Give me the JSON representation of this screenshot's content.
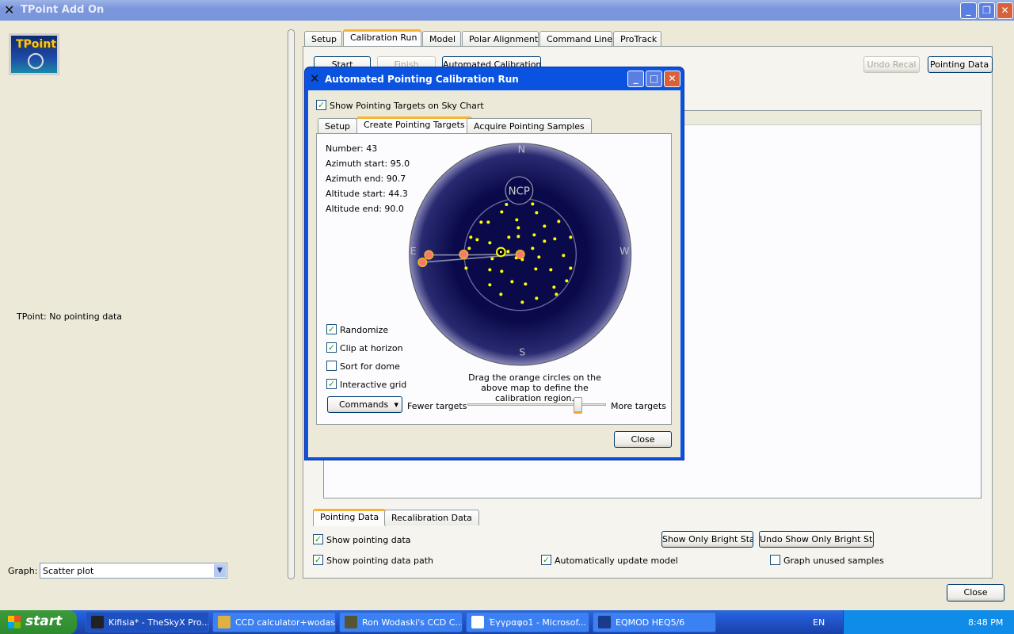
{
  "window": {
    "title": "TPoint Add On",
    "status": "TPoint: No pointing data",
    "graph_label": "Graph:",
    "graph_value": "Scatter plot",
    "close": "Close",
    "logo_text": "TPoint"
  },
  "main_tabs": [
    "Setup",
    "Calibration Run",
    "Model",
    "Polar Alignment",
    "Command Line",
    "ProTrack"
  ],
  "toolbar": {
    "start": "Start",
    "finish": "Finish",
    "automated": "Automated Calibration",
    "undo_recal": "Undo Recal",
    "pointing_data_menu": "Pointing Data"
  },
  "data_tabs": [
    "Pointing Data",
    "Recalibration Data"
  ],
  "options": {
    "show_pointing_data": "Show pointing data",
    "show_pointing_data_path": "Show pointing data path",
    "auto_update": "Automatically update model",
    "graph_unused": "Graph unused samples",
    "show_bright": "Show Only Bright Stars",
    "undo_bright": "Undo Show Only Bright Stars"
  },
  "dialog": {
    "title": "Automated Pointing Calibration Run",
    "show_targets": "Show Pointing Targets on Sky Chart",
    "tabs": [
      "Setup",
      "Create Pointing Targets",
      "Acquire Pointing Samples"
    ],
    "stats": {
      "number": "Number: 43",
      "az_start": "Azimuth start:  95.0",
      "az_end": "Azimuth end:  90.7",
      "alt_start": "Altitude start:  44.3",
      "alt_end": "Altitude end:  90.0"
    },
    "checks": [
      {
        "label": "Randomize",
        "checked": true
      },
      {
        "label": "Clip at horizon",
        "checked": true
      },
      {
        "label": "Sort for dome",
        "checked": false
      },
      {
        "label": "Interactive grid",
        "checked": true
      }
    ],
    "hint": "Drag the orange circles on the above map to define the calibration region.",
    "commands": "Commands",
    "fewer": "Fewer targets",
    "more": "More targets",
    "slider_value": 0.8,
    "close": "Close",
    "compass": {
      "n": "N",
      "s": "S",
      "e": "E",
      "w": "W",
      "ncp": "NCP"
    },
    "colors": {
      "sky": "#0a0a4a",
      "target": "#ffff00",
      "handle": "#f87a6e"
    }
  },
  "taskbar": {
    "start": "start",
    "items": [
      "Kifisia* - TheSkyX Pro...",
      "CCD calculator+wodaski",
      "Ron Wodaski's CCD C...",
      "Έγγραφο1 - Microsof...",
      "EQMOD HEQ5/6"
    ],
    "lang": "EN",
    "time": "8:48 PM"
  }
}
